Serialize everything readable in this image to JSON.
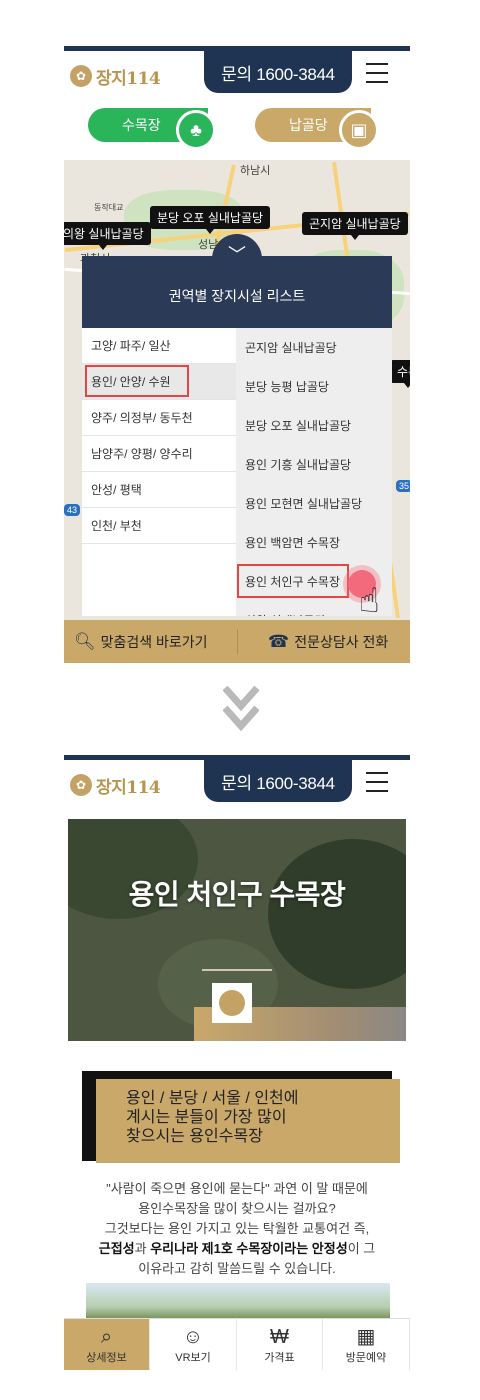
{
  "header": {
    "logo_text": "장지114",
    "phone_label": "문의 1600-3844"
  },
  "tabs": [
    {
      "label": "수목장",
      "icon": "tree-icon",
      "color": "#2bb55a"
    },
    {
      "label": "납골당",
      "icon": "urn-icon",
      "color": "#c9a86a"
    }
  ],
  "map": {
    "labels": [
      "하남시",
      "동작대교",
      "과천시",
      "성남시"
    ],
    "pins": [
      "의왕 실내납골당",
      "분당 오포 실내납골당",
      "곤지암 실내납골당",
      "수목"
    ],
    "route_badges": [
      "43",
      "35"
    ]
  },
  "panel": {
    "title": "권역별 장지시설 리스트",
    "regions": [
      "고양/ 파주/ 일산",
      "용인/ 안양/ 수원",
      "양주/ 의정부/ 동두천",
      "남양주/ 양평/ 양수리",
      "안성/ 평택",
      "인천/ 부천"
    ],
    "selected_region": "용인/ 안양/ 수원",
    "facilities": [
      "곤지암 실내납골당",
      "분당 능평 납골당",
      "분당 오포 실내납골당",
      "용인 기흥 실내납골당",
      "용인 모현면 실내납골당",
      "용인 백암면 수목장",
      "용인 처인구 수목장",
      "의왕 실내납골당"
    ],
    "selected_facility": "용인 처인구 수목장"
  },
  "bottom_bar": {
    "search_label": "맞춤검색 바로가기",
    "call_label": "전문상담사 전화"
  },
  "detail": {
    "hero_title": "용인 처인구 수목장",
    "headline": [
      "용인 / 분당 / 서울 / 인천에",
      "계시는 분들이 가장 많이",
      "찾으시는 용인수목장"
    ],
    "body": {
      "line1": "\"사람이 죽으면 용인에 묻는다\" 과연 이 말 때문에",
      "line2": "용인수목장을 많이 찾으시는 걸까요?",
      "line3": "그것보다는 용인 가지고 있는 탁월한 교통여건 즉,",
      "line4_bold1": "근접성",
      "line4_mid": "과 ",
      "line4_bold2": "우리나라 제1호 수목장이라는 안정성",
      "line4_end": "이 그",
      "line5": "이유라고 감히 말씀드릴 수 있습니다."
    },
    "nav": [
      {
        "label": "상세정보",
        "icon": "magnifier-icon",
        "active": true
      },
      {
        "label": "VR보기",
        "icon": "vr-person-icon",
        "active": false
      },
      {
        "label": "가격표",
        "icon": "price-icon",
        "active": false
      },
      {
        "label": "방문예약",
        "icon": "calendar-check-icon",
        "active": false
      }
    ]
  },
  "colors": {
    "navy": "#1f3352",
    "gold": "#c9a86a",
    "green": "#2bb55a",
    "highlight": "#e64545"
  }
}
